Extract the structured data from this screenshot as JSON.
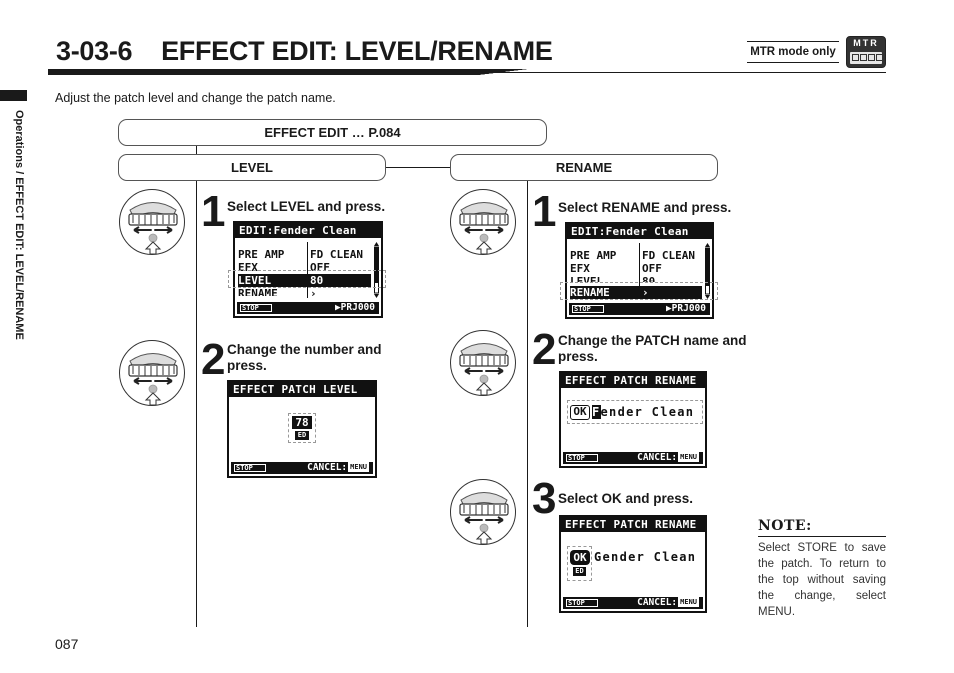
{
  "header": {
    "section_number": "3-03-6",
    "title": "EFFECT EDIT: LEVEL/RENAME",
    "intro": "Adjust the patch level and change the patch name.",
    "mode_label": "MTR mode only",
    "mode_badge": "MTR"
  },
  "side_label": "Operations / EFFECT EDIT: LEVEL/RENAME",
  "page_number": "087",
  "flow": {
    "parent": "EFFECT EDIT … P.084",
    "branches": [
      "LEVEL",
      "RENAME"
    ]
  },
  "level_steps": [
    {
      "number": "1",
      "text": "Select LEVEL and press.",
      "screen": {
        "header": "EDIT:Fender Clean",
        "rows": [
          {
            "key": "PRE AMP",
            "value": "FD CLEAN"
          },
          {
            "key": "EFX",
            "value": "OFF"
          },
          {
            "key": "LEVEL",
            "value": "80",
            "selected": true
          },
          {
            "key": "RENAME",
            "value": "›"
          }
        ],
        "footer_left": "STOP",
        "footer_right": "▶PRJ000"
      }
    },
    {
      "number": "2",
      "text": "Change the number and press.",
      "screen": {
        "header": "EFFECT PATCH LEVEL",
        "value": "78",
        "value_badge": "ED",
        "footer_left": "STOP",
        "footer_right": "CANCEL:",
        "footer_key": "MENU"
      }
    }
  ],
  "rename_steps": [
    {
      "number": "1",
      "text": "Select RENAME and press.",
      "screen": {
        "header": "EDIT:Fender Clean",
        "rows": [
          {
            "key": "PRE AMP",
            "value": "FD CLEAN"
          },
          {
            "key": "EFX",
            "value": "OFF"
          },
          {
            "key": "LEVEL",
            "value": "80"
          },
          {
            "key": "RENAME",
            "value": "›",
            "selected": true
          }
        ],
        "footer_left": "STOP",
        "footer_right": "▶PRJ000"
      }
    },
    {
      "number": "2",
      "text": "Change the PATCH name and press.",
      "screen": {
        "header": "EFFECT PATCH RENAME",
        "ok_label": "OK",
        "cursor_char": "F",
        "name_rest": "ender Clean",
        "footer_left": "STOP",
        "footer_right": "CANCEL:",
        "footer_key": "MENU"
      }
    },
    {
      "number": "3",
      "text": "Select OK and press.",
      "screen": {
        "header": "EFFECT PATCH RENAME",
        "ok_label": "OK",
        "ok_badge": "ED",
        "name": "Gender Clean",
        "footer_left": "STOP",
        "footer_right": "CANCEL:",
        "footer_key": "MENU"
      }
    }
  ],
  "note": {
    "title": "NOTE:",
    "body": "Select STORE to save the patch. To return to the top without saving the change, select MENU."
  }
}
